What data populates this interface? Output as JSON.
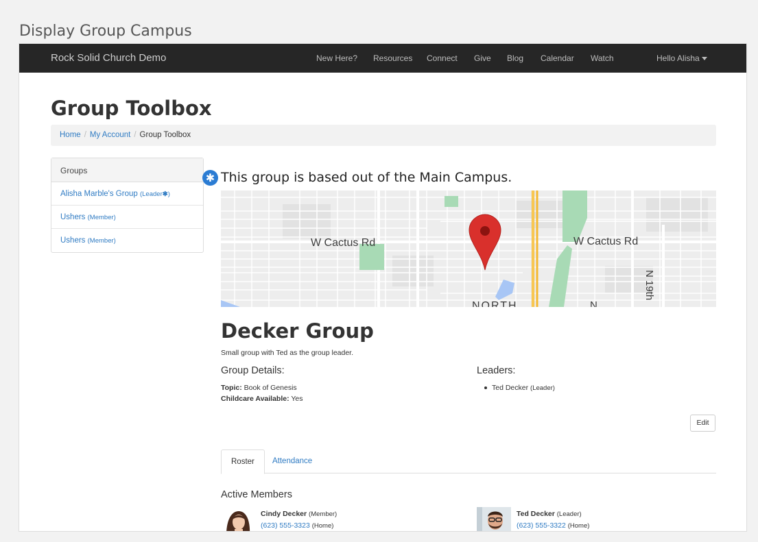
{
  "caption": "Display Group Campus",
  "navbar": {
    "brand": "Rock Solid Church Demo",
    "items": [
      "New Here?",
      "Resources",
      "Connect",
      "Give",
      "Blog",
      "Calendar",
      "Watch"
    ],
    "user_menu": "Hello Alisha"
  },
  "page_title": "Group Toolbox",
  "breadcrumb": [
    "Home",
    "My Account",
    "Group Toolbox"
  ],
  "groups_panel": {
    "heading": "Groups",
    "items": [
      {
        "name": "Alisha Marble's Group",
        "role": "(Leader",
        "role_suffix": ")",
        "campus_marker": "✱"
      },
      {
        "name": "Ushers",
        "role": "(Member)"
      },
      {
        "name": "Ushers",
        "role": "(Member)"
      }
    ]
  },
  "campus_marker": "✱",
  "campus_heading": "This group is based out of the Main Campus.",
  "map": {
    "labels": [
      "W Cactus Rd",
      "W Cactus Rd",
      "NORTH",
      "N 19th",
      "N"
    ],
    "pin_icon": "map-pin-icon"
  },
  "group": {
    "title": "Decker Group",
    "description": "Small group with Ted as the group leader.",
    "details_heading": "Group Details:",
    "topic_label": "Topic:",
    "topic_value": "Book of Genesis",
    "childcare_label": "Childcare Available:",
    "childcare_value": "Yes",
    "leaders_heading": "Leaders:",
    "leader_name": "Ted Decker",
    "leader_role": "(Leader)",
    "edit_label": "Edit"
  },
  "tabs": [
    "Roster",
    "Attendance"
  ],
  "members_heading": "Active Members",
  "members": [
    {
      "name": "Cindy Decker",
      "role": "(Member)",
      "phone": "(623) 555-3323",
      "phone_type": "(Home)"
    },
    {
      "name": "Ted Decker",
      "role": "(Leader)",
      "phone": "(623) 555-3322",
      "phone_type": "(Home)"
    }
  ],
  "colors": {
    "navbar": "#262626",
    "link": "#2f7bc3",
    "marker": "#2b7cd3",
    "map_pin": "#d9302c",
    "road_major": "#f5b931"
  }
}
